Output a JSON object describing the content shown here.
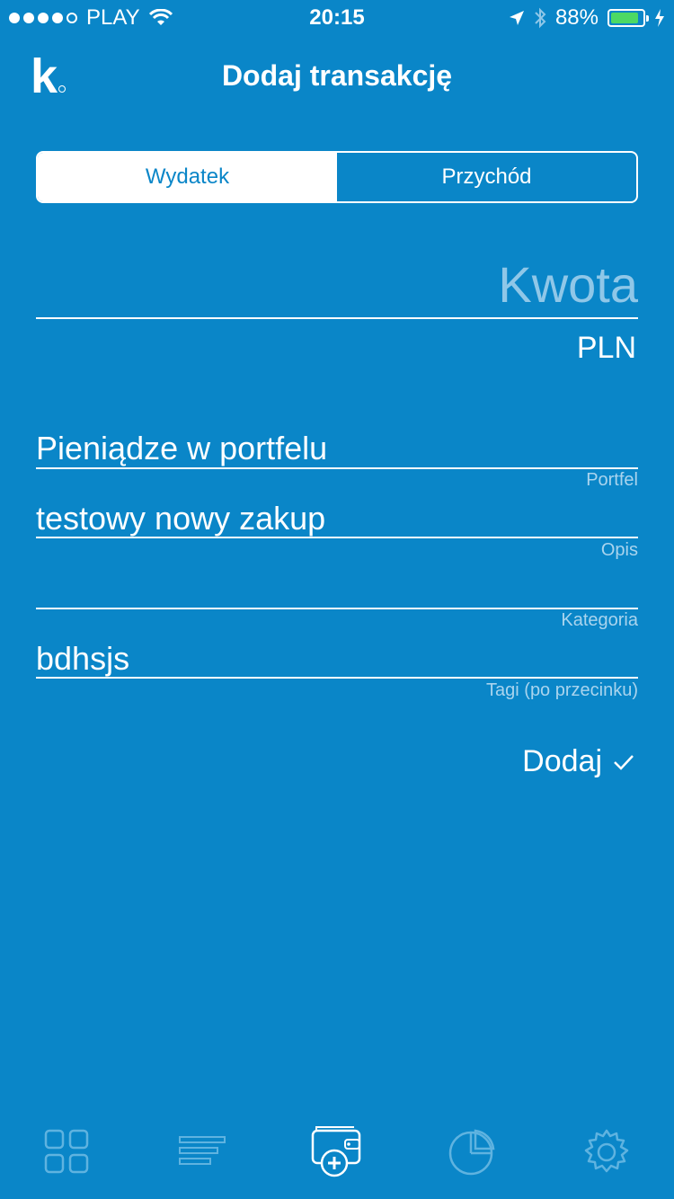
{
  "status_bar": {
    "carrier": "PLAY",
    "time": "20:15",
    "battery_percent": "88%",
    "battery_level": 0.88
  },
  "header": {
    "logo": "k",
    "title": "Dodaj transakcję"
  },
  "segment": {
    "options": [
      "Wydatek",
      "Przychód"
    ],
    "selected": "Wydatek"
  },
  "amount": {
    "placeholder": "Kwota",
    "value": "",
    "currency": "PLN"
  },
  "fields": {
    "wallet": {
      "value": "Pieniądze w portfelu",
      "label": "Portfel"
    },
    "description": {
      "value": "testowy nowy zakup",
      "label": "Opis"
    },
    "category": {
      "value": "",
      "label": "Kategoria"
    },
    "tags": {
      "value": "bdhsjs",
      "label": "Tagi (po przecinku)"
    }
  },
  "actions": {
    "add_label": "Dodaj"
  },
  "tabbar": {
    "tabs": [
      "dashboard-grid-icon",
      "list-icon",
      "add-transaction-wallet-icon",
      "pie-chart-icon",
      "settings-gear-icon"
    ]
  },
  "colors": {
    "background": "#0a86c8",
    "text": "#ffffff",
    "placeholder": "#8fc7e8",
    "battery": "#4cd964"
  }
}
